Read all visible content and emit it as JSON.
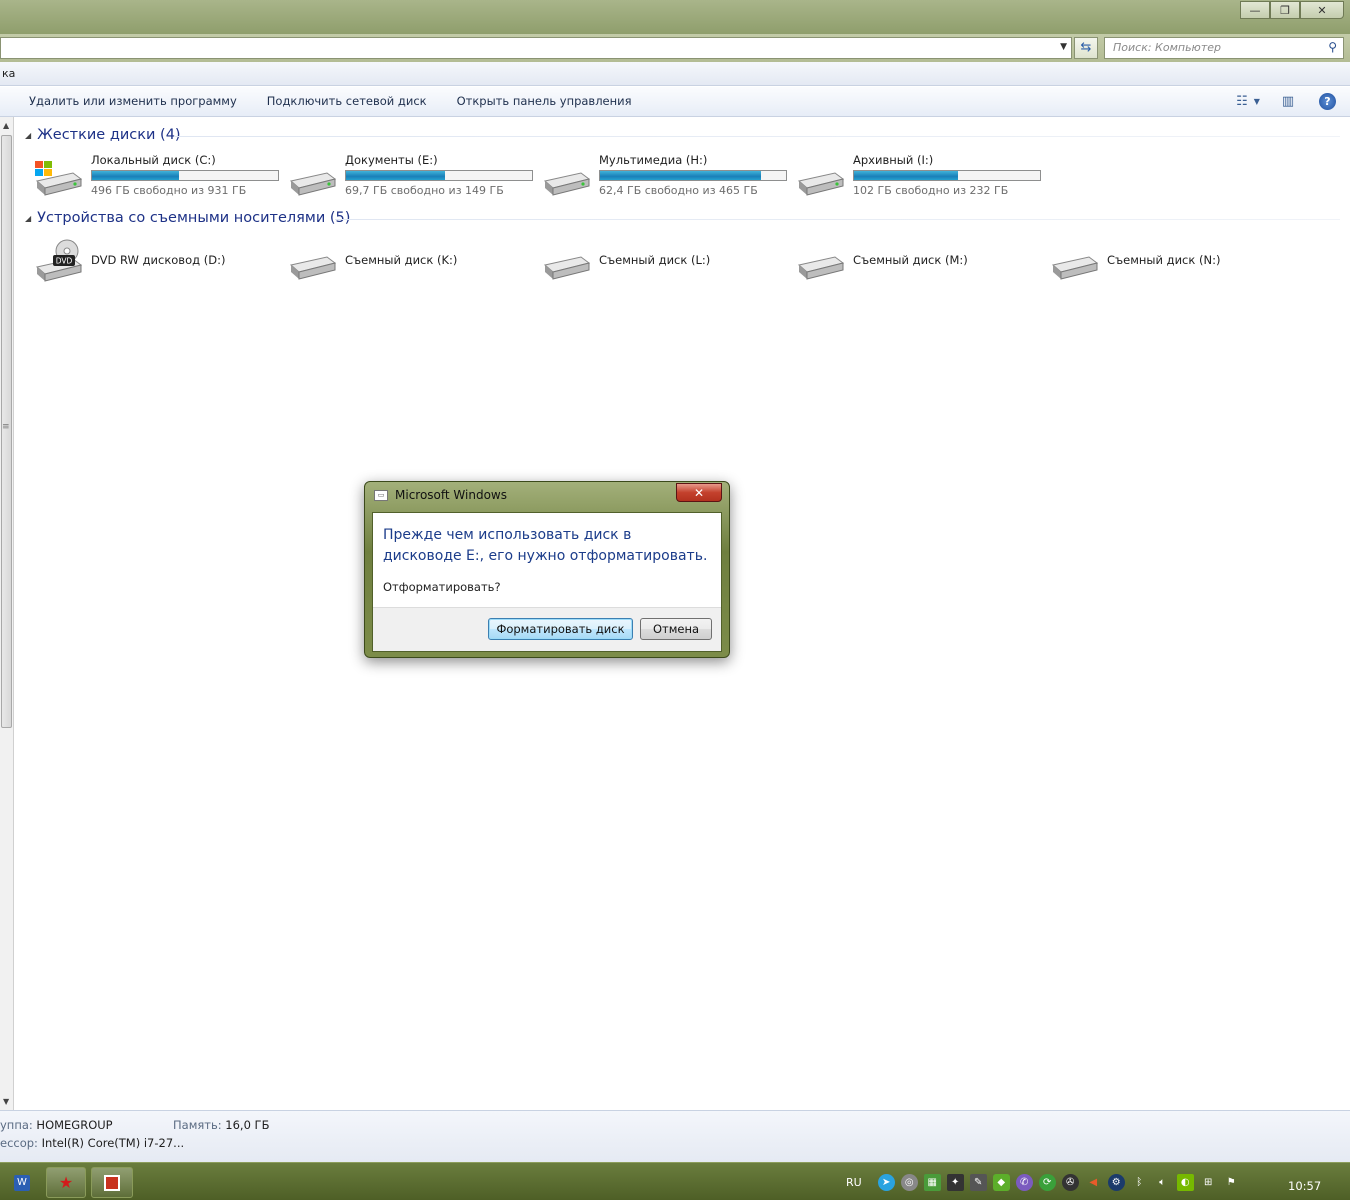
{
  "window": {
    "search_placeholder": "Поиск: Компьютер"
  },
  "menubar": {
    "fragment": "ка"
  },
  "toolbar": {
    "buttons": [
      "Удалить или изменить программу",
      "Подключить сетевой диск",
      "Открыть панель управления"
    ]
  },
  "groups": {
    "hard": {
      "title": "Жесткие диски (4)",
      "drives": [
        {
          "name": "Локальный диск (C:)",
          "free": "496 ГБ свободно из 931 ГБ",
          "used_fraction": 0.467
        },
        {
          "name": "Документы (E:)",
          "free": "69,7 ГБ свободно из 149 ГБ",
          "used_fraction": 0.532
        },
        {
          "name": "Мультимедиа (H:)",
          "free": "62,4 ГБ свободно из 465 ГБ",
          "used_fraction": 0.866
        },
        {
          "name": "Архивный (I:)",
          "free": "102 ГБ свободно из 232 ГБ",
          "used_fraction": 0.56
        }
      ]
    },
    "removable": {
      "title": "Устройства со съемными носителями (5)",
      "devices": [
        {
          "name": "DVD RW дисковод (D:)"
        },
        {
          "name": "Съемный диск (K:)"
        },
        {
          "name": "Съемный диск (L:)"
        },
        {
          "name": "Съемный диск (M:)"
        },
        {
          "name": "Съемный диск (N:)"
        }
      ]
    }
  },
  "status": {
    "workgroup_label": "уппа:",
    "workgroup_value": "HOMEGROUP",
    "memory_label": "Память:",
    "memory_value": "16,0 ГБ",
    "cpu_label": "ессор:",
    "cpu_value": "Intel(R) Core(TM) i7-27..."
  },
  "dialog": {
    "title": "Microsoft Windows",
    "message": "Прежде чем использовать диск в дисководе E:, его нужно отформатировать.",
    "question": "Отформатировать?",
    "format_button": "Форматировать диск",
    "cancel_button": "Отмена"
  },
  "taskbar": {
    "language": "RU",
    "clock": "10:57"
  },
  "colors": {
    "accent_title": "#1e3287",
    "bar_fill": "#1a7fb8",
    "taskbar": "#5a6c2f"
  }
}
